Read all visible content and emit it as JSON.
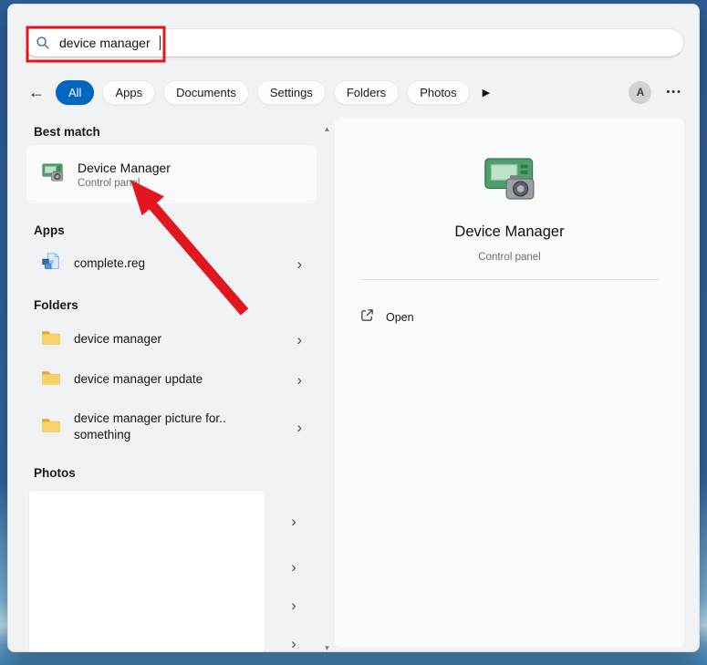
{
  "search": {
    "value": "device manager"
  },
  "tabs": {
    "items": [
      {
        "label": "All",
        "active": true
      },
      {
        "label": "Apps"
      },
      {
        "label": "Documents"
      },
      {
        "label": "Settings"
      },
      {
        "label": "Folders"
      },
      {
        "label": "Photos"
      }
    ]
  },
  "account": {
    "initial": "A"
  },
  "results": {
    "best_match": {
      "header": "Best match",
      "title": "Device Manager",
      "subtitle": "Control panel"
    },
    "apps": {
      "header": "Apps",
      "items": [
        {
          "label": "complete.reg"
        }
      ]
    },
    "folders": {
      "header": "Folders",
      "items": [
        {
          "label": "device manager"
        },
        {
          "label": "device manager update"
        },
        {
          "label": "device manager picture for.. something"
        }
      ]
    },
    "photos": {
      "header": "Photos"
    }
  },
  "preview": {
    "title": "Device Manager",
    "subtitle": "Control panel",
    "open_label": "Open"
  },
  "icons": {
    "chevron": "›",
    "back_arrow": "←",
    "more_tabs": "▶",
    "ellipsis": "•••",
    "scroll_up": "▲",
    "scroll_down": "▼"
  },
  "colors": {
    "accent": "#0067c0",
    "annotation_red": "#e1161f"
  }
}
